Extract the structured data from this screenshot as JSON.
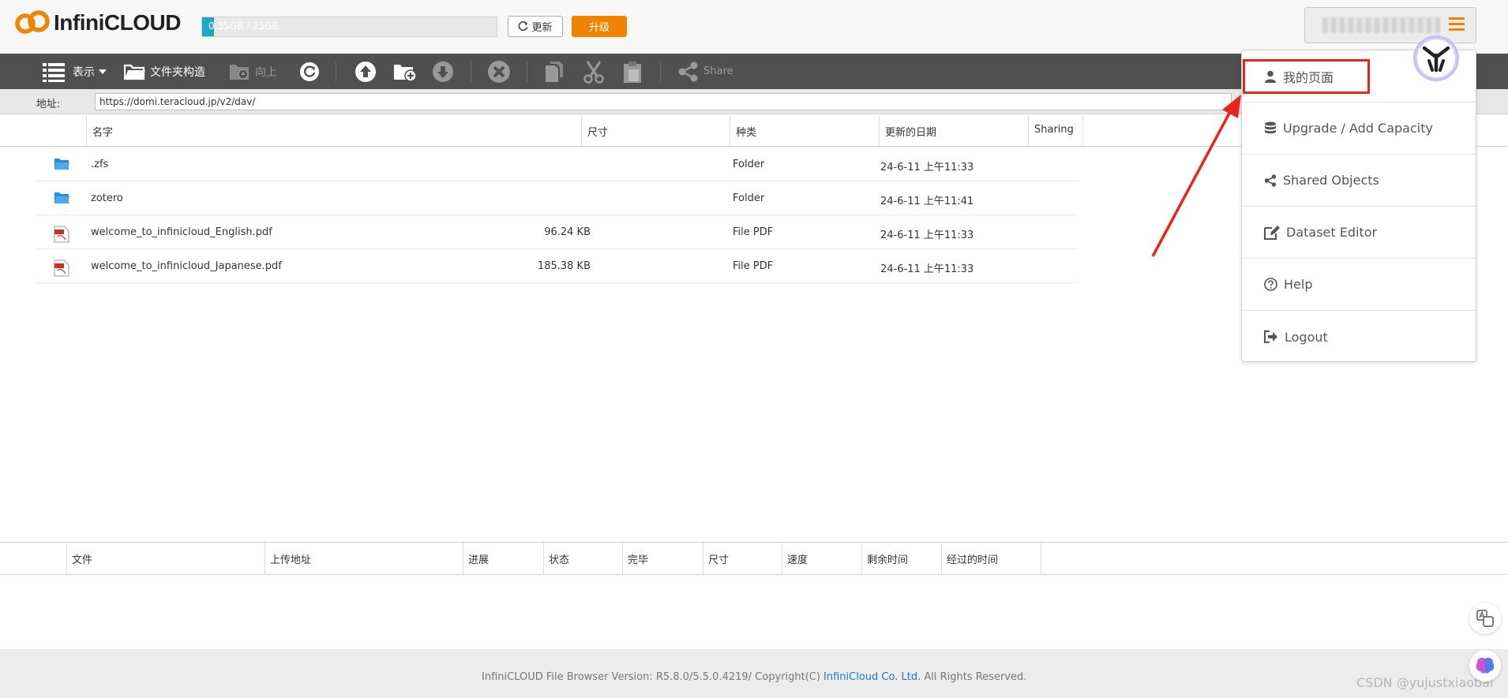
{
  "header": {
    "logo_text": "InfiniCLOUD",
    "quota_text": "0.35GB / 25GB",
    "quota_fraction": 0.014,
    "refresh_label": "更新",
    "upgrade_label": "升级"
  },
  "toolbar": {
    "view_label": "表示",
    "folder_tree_label": "文件夹构造",
    "up_label": "向上",
    "share_label": "Share"
  },
  "address": {
    "label": "地址:",
    "value": "https://domi.teracloud.jp/v2/dav/"
  },
  "file_table": {
    "columns": [
      "名字",
      "尺寸",
      "种类",
      "更新的日期",
      "Sharing"
    ],
    "rows": [
      {
        "icon": "folder-icon",
        "name": ".zfs",
        "size": "",
        "kind": "Folder",
        "date": "24-6-11 上午11:33"
      },
      {
        "icon": "folder-icon",
        "name": "zotero",
        "size": "",
        "kind": "Folder",
        "date": "24-6-11 上午11:41"
      },
      {
        "icon": "pdf-icon",
        "name": "welcome_to_infinicloud_English.pdf",
        "size": "96.24 KB",
        "kind": "File PDF",
        "date": "24-6-11 上午11:33"
      },
      {
        "icon": "pdf-icon",
        "name": "welcome_to_infinicloud_Japanese.pdf",
        "size": "185.38 KB",
        "kind": "File PDF",
        "date": "24-6-11 上午11:33"
      }
    ]
  },
  "upload_table": {
    "columns": [
      "文件",
      "上传地址",
      "进展",
      "状态",
      "完毕",
      "尺寸",
      "速度",
      "剩余时间",
      "经过的时间"
    ]
  },
  "user_menu": {
    "items": [
      {
        "icon": "user-icon",
        "label": "我的页面"
      },
      {
        "icon": "database-icon",
        "label": "Upgrade / Add Capacity"
      },
      {
        "icon": "share-icon",
        "label": "Shared Objects"
      },
      {
        "icon": "edit-icon",
        "label": "Dataset Editor"
      },
      {
        "icon": "help-icon",
        "label": "Help"
      },
      {
        "icon": "logout-icon",
        "label": "Logout"
      }
    ]
  },
  "footer": {
    "prefix": "InfiniCLOUD File Browser Version: R5.8.0/5.5.0.4219/ Copyright(C) ",
    "link": "InfiniCloud Co. Ltd.",
    "suffix": " All Rights Reserved."
  },
  "watermark": "CSDN @yujustxiaobai",
  "colors": {
    "accent": "#f08300",
    "toolbar_bg": "#505050",
    "highlight": "#e8241b",
    "link": "#1a7ac8",
    "folder": "#2a8ce0"
  }
}
